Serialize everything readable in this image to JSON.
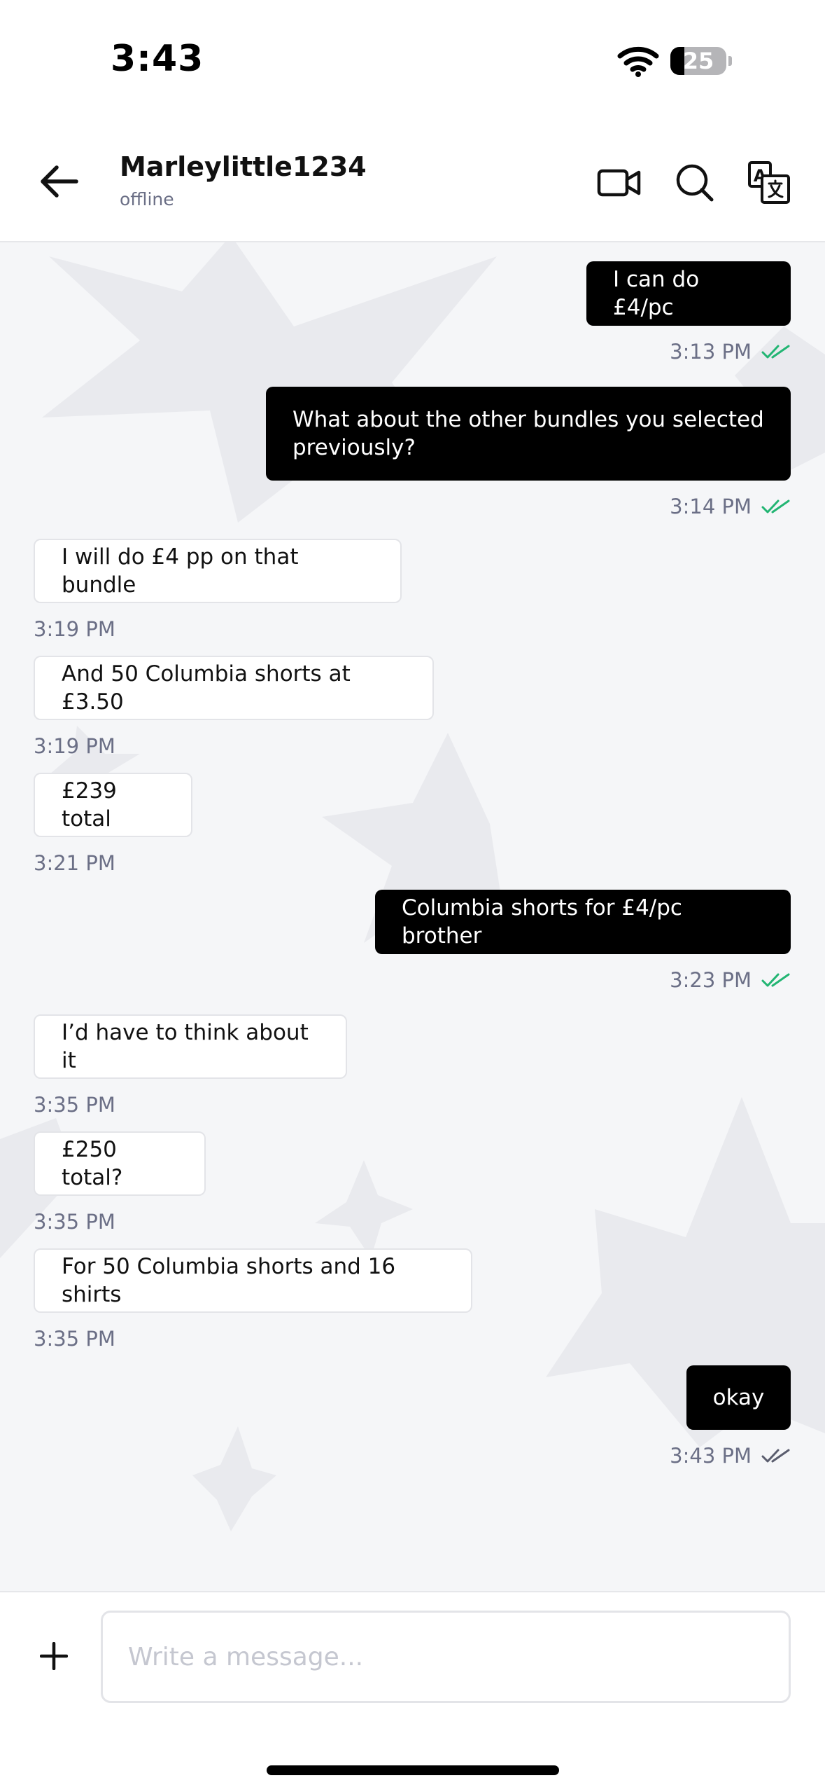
{
  "status_bar": {
    "time": "3:43",
    "battery_level": "25",
    "battery_fraction": 0.25
  },
  "header": {
    "contact_name": "Marleylittle1234",
    "contact_status": "offline",
    "icons": [
      "back-arrow-icon",
      "video-call-icon",
      "search-icon",
      "translate-icon"
    ]
  },
  "messages": [
    {
      "direction": "out",
      "text": "I can do £4/pc",
      "time": "3:13 PM",
      "read": true
    },
    {
      "direction": "out",
      "text": "What about the other bundles you selected previously?",
      "time": "3:14 PM",
      "read": true
    },
    {
      "direction": "in",
      "text": "I will do £4 pp on that bundle",
      "time": "3:19 PM"
    },
    {
      "direction": "in",
      "text": "And 50 Columbia shorts at £3.50",
      "time": "3:19 PM"
    },
    {
      "direction": "in",
      "text": "£239 total",
      "time": "3:21 PM"
    },
    {
      "direction": "out",
      "text": "Columbia shorts for £4/pc brother",
      "time": "3:23 PM",
      "read": true
    },
    {
      "direction": "in",
      "text": "I’d have to think about it",
      "time": "3:35 PM"
    },
    {
      "direction": "in",
      "text": "£250 total?",
      "time": "3:35 PM"
    },
    {
      "direction": "in",
      "text": "For 50 Columbia shorts and 16 shirts",
      "time": "3:35 PM"
    },
    {
      "direction": "out",
      "text": "okay",
      "time": "3:43 PM",
      "read": false
    }
  ],
  "composer": {
    "placeholder": "Write a message..."
  },
  "colors": {
    "read_tick": "#22b573",
    "sent_tick": "#5a5d6e",
    "outgoing_bubble": "#000000",
    "incoming_bubble": "#ffffff",
    "chat_background": "#f5f6f8"
  }
}
